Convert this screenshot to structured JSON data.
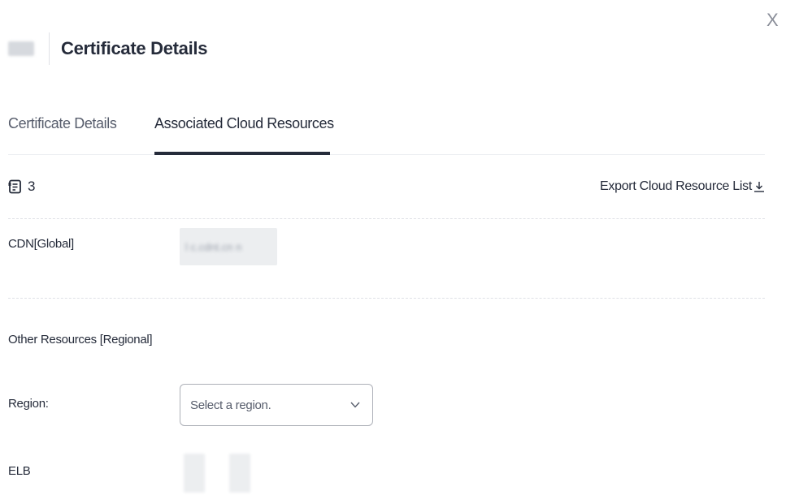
{
  "dialog": {
    "close_label": "X",
    "title": "Certificate Details"
  },
  "tabs": [
    {
      "label": "Certificate Details",
      "active": false
    },
    {
      "label": "Associated Cloud Resources",
      "active": true
    }
  ],
  "summary": {
    "resource_count": "3",
    "export_label": "Export Cloud Resource List"
  },
  "cdn": {
    "label": "CDN[Global]"
  },
  "regional": {
    "section_label": "Other Resources [Regional]",
    "region_label": "Region:",
    "region_placeholder": "Select a region.",
    "elb_label": "ELB"
  },
  "icons": {
    "close": "close-icon",
    "count": "document-icon",
    "export": "download-icon",
    "select": "chevron-down-icon"
  },
  "colors": {
    "text": "#252b3a",
    "muted": "#575d6c",
    "border": "#adb0b8",
    "divider": "#dfe1e6"
  }
}
